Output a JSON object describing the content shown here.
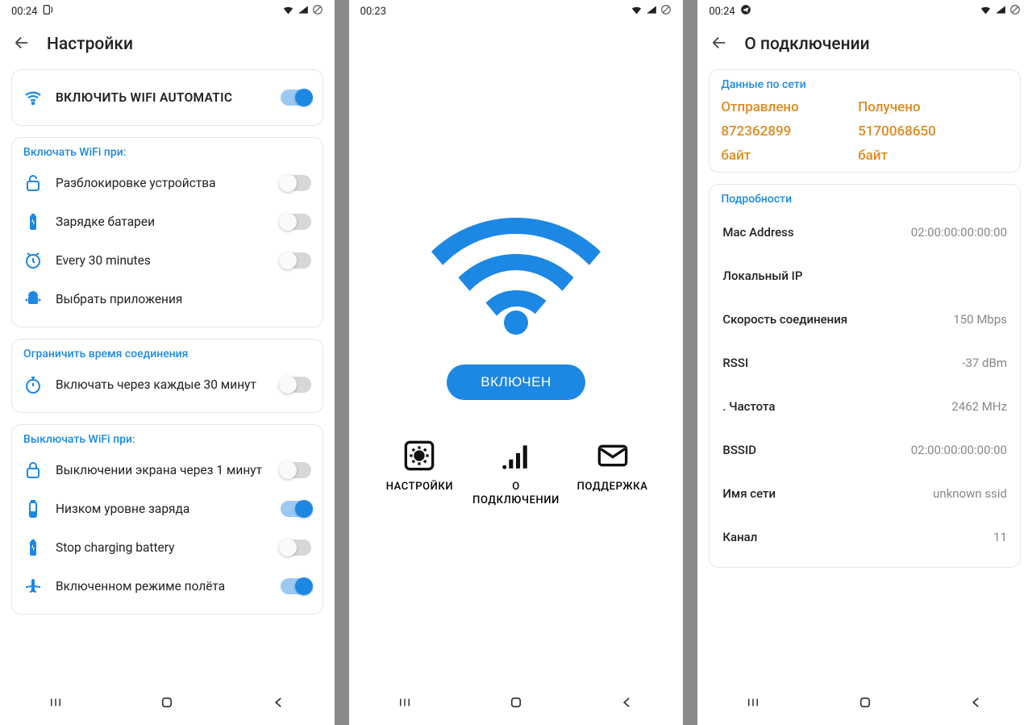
{
  "screen1": {
    "time": "00:24",
    "title": "Настройки",
    "enable_card": {
      "label": "ВКЛЮЧИТЬ WIFI AUTOMATIC",
      "on": true
    },
    "sec_on_title": "Включать WiFi при:",
    "on_rows": [
      {
        "label": "Разблокировке устройства",
        "on": false
      },
      {
        "label": "Зарядке батареи",
        "on": false
      },
      {
        "label": "Every 30 minutes",
        "on": false
      },
      {
        "label": "Выбрать приложения",
        "toggle": false
      }
    ],
    "sec_limit_title": "Ограничить время соединения",
    "limit_row": {
      "label": "Включать через каждые  30 минут",
      "on": false
    },
    "sec_off_title": "Выключать WiFi при:",
    "off_rows": [
      {
        "label": "Выключении экрана через 1 минут",
        "on": false
      },
      {
        "label": "Низком уровне заряда",
        "on": true
      },
      {
        "label": "Stop charging battery",
        "on": false
      },
      {
        "label": "Включенном режиме полёта",
        "on": true
      }
    ]
  },
  "screen2": {
    "time": "00:23",
    "pill": "ВКЛЮЧЕН",
    "btns": [
      {
        "cap": "НАСТРОЙКИ"
      },
      {
        "cap": "О ПОДКЛЮЧЕНИИ"
      },
      {
        "cap": "ПОДДЕРЖКА"
      }
    ]
  },
  "screen3": {
    "time": "00:24",
    "title": "О подключении",
    "net_title": "Данные по сети",
    "net": {
      "sent_label": "Отправлено",
      "recv_label": "Получено",
      "sent_val": "872362899",
      "recv_val": "5170068650",
      "sent_unit": "байт",
      "recv_unit": "байт"
    },
    "details_title": "Подробности",
    "details": [
      {
        "k": "Mac Address",
        "v": "02:00:00:00:00:00"
      },
      {
        "k": "Локальный IP",
        "v": ""
      },
      {
        "k": "Скорость соединения",
        "v": "150 Mbps"
      },
      {
        "k": "RSSI",
        "v": "-37 dBm"
      },
      {
        "k": ". Частота",
        "v": "2462 MHz"
      },
      {
        "k": "BSSID",
        "v": "02:00:00:00:00:00"
      },
      {
        "k": "Имя сети",
        "v": "unknown ssid"
      },
      {
        "k": "Канал",
        "v": "11"
      }
    ]
  }
}
